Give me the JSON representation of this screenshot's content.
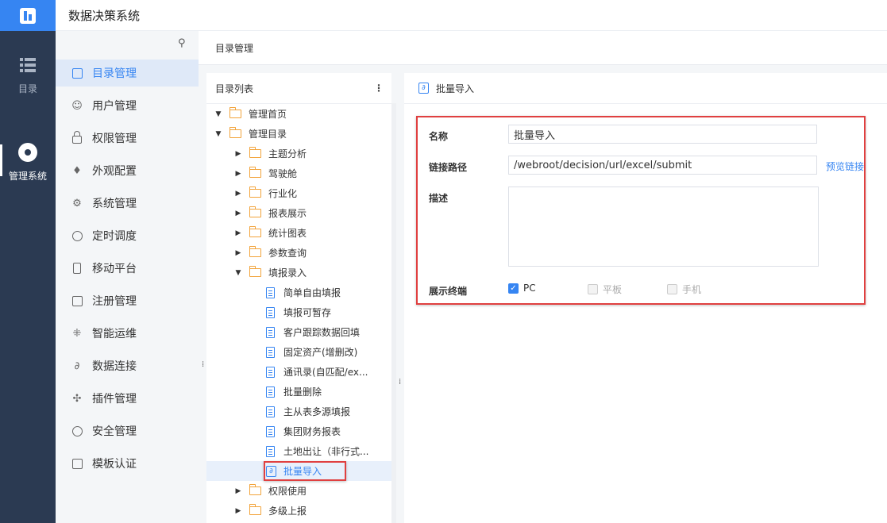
{
  "app": {
    "title": "数据决策系统"
  },
  "rail": {
    "items": [
      {
        "label": "目录",
        "icon": "list-icon",
        "active": false
      },
      {
        "label": "管理系统",
        "icon": "gear-icon",
        "active": true
      }
    ]
  },
  "menu": {
    "items": [
      {
        "label": "目录管理",
        "icon": "catalog-icon",
        "active": true
      },
      {
        "label": "用户管理",
        "icon": "user-icon"
      },
      {
        "label": "权限管理",
        "icon": "lock-icon"
      },
      {
        "label": "外观配置",
        "icon": "brush-icon"
      },
      {
        "label": "系统管理",
        "icon": "settings-icon"
      },
      {
        "label": "定时调度",
        "icon": "timer-icon"
      },
      {
        "label": "移动平台",
        "icon": "mobile-icon"
      },
      {
        "label": "注册管理",
        "icon": "register-icon"
      },
      {
        "label": "智能运维",
        "icon": "network-icon"
      },
      {
        "label": "数据连接",
        "icon": "link-icon"
      },
      {
        "label": "插件管理",
        "icon": "plugin-icon"
      },
      {
        "label": "安全管理",
        "icon": "shield-icon"
      },
      {
        "label": "模板认证",
        "icon": "template-icon"
      }
    ]
  },
  "breadcrumb": "目录管理",
  "tree": {
    "header": "目录列表",
    "more_icon": "⋮",
    "rows": [
      {
        "label": "管理首页",
        "level": 0,
        "type": "folder",
        "arrow": "▼"
      },
      {
        "label": "管理目录",
        "level": 0,
        "type": "folder",
        "arrow": "▼"
      },
      {
        "label": "主题分析",
        "level": 1,
        "type": "folder",
        "arrow": "▶"
      },
      {
        "label": "驾驶舱",
        "level": 1,
        "type": "folder",
        "arrow": "▶"
      },
      {
        "label": "行业化",
        "level": 1,
        "type": "folder",
        "arrow": "▶"
      },
      {
        "label": "报表展示",
        "level": 1,
        "type": "folder",
        "arrow": "▶"
      },
      {
        "label": "统计图表",
        "level": 1,
        "type": "folder",
        "arrow": "▶"
      },
      {
        "label": "参数查询",
        "level": 1,
        "type": "folder",
        "arrow": "▶"
      },
      {
        "label": "填报录入",
        "level": 1,
        "type": "folder",
        "arrow": "▼"
      },
      {
        "label": "简单自由填报",
        "level": 2,
        "type": "doc"
      },
      {
        "label": "填报可暂存",
        "level": 2,
        "type": "doc"
      },
      {
        "label": "客户跟踪数据回填",
        "level": 2,
        "type": "doc"
      },
      {
        "label": "固定资产(增删改)",
        "level": 2,
        "type": "doc"
      },
      {
        "label": "通讯录(自匹配/ex...",
        "level": 2,
        "type": "doc"
      },
      {
        "label": "批量删除",
        "level": 2,
        "type": "doc"
      },
      {
        "label": "主从表多源填报",
        "level": 2,
        "type": "doc"
      },
      {
        "label": "集团财务报表",
        "level": 2,
        "type": "doc"
      },
      {
        "label": "土地出让（非行式...",
        "level": 2,
        "type": "doc"
      },
      {
        "label": "批量导入",
        "level": 2,
        "type": "link",
        "selected": true
      },
      {
        "label": "权限使用",
        "level": 1,
        "type": "folder",
        "arrow": "▶"
      },
      {
        "label": "多级上报",
        "level": 1,
        "type": "folder",
        "arrow": "▶"
      }
    ]
  },
  "detail": {
    "title": "批量导入",
    "form": {
      "name_label": "名称",
      "name_value": "批量导入",
      "path_label": "链接路径",
      "path_value": "/webroot/decision/url/excel/submit",
      "preview_label": "预览链接",
      "desc_label": "描述",
      "desc_value": "",
      "terminal_label": "展示终端",
      "terminals": [
        {
          "label": "PC",
          "checked": true
        },
        {
          "label": "平板",
          "checked": false
        },
        {
          "label": "手机",
          "checked": false
        }
      ]
    }
  },
  "colors": {
    "accent": "#3685f2",
    "rail": "#2b3a52",
    "highlight": "#e04040",
    "folder": "#f2a33a"
  }
}
